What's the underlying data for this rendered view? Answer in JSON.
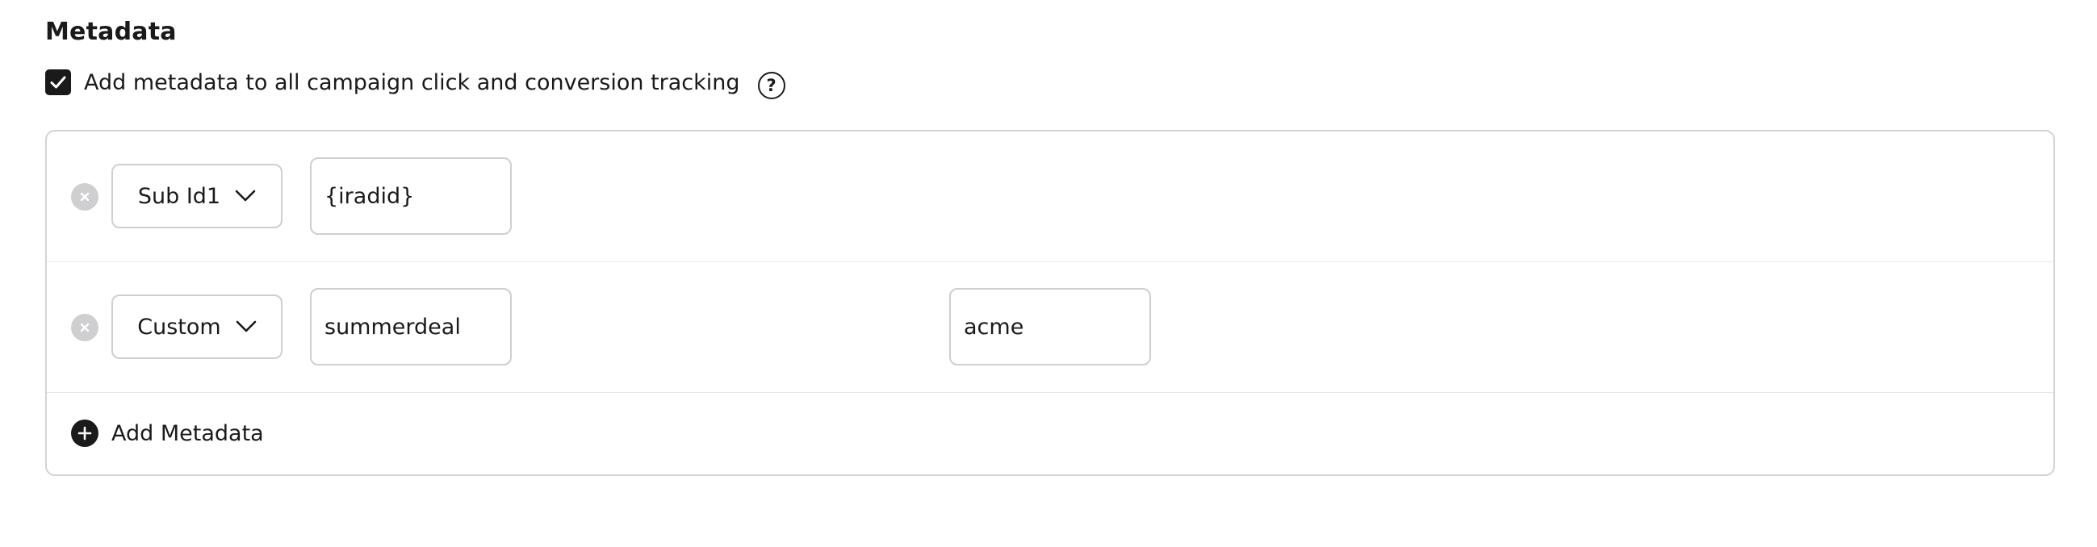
{
  "section": {
    "title": "Metadata",
    "checkbox_label": "Add metadata to all campaign click and conversion tracking",
    "checkbox_checked": true,
    "help_icon": "question-circle-icon"
  },
  "rows": [
    {
      "type_select": "Sub Id1",
      "key_value": "{iradid}",
      "remove_icon": "close-circle-icon"
    },
    {
      "type_select": "Custom",
      "key_value": "summerdeal",
      "extra_value": "acme",
      "remove_icon": "close-circle-icon"
    }
  ],
  "add_button": {
    "label": "Add Metadata",
    "icon": "plus-circle-icon"
  },
  "colors": {
    "text": "#1a1a1a",
    "border": "#cfcfd2",
    "remove_icon_bg": "#cfcfd1"
  }
}
